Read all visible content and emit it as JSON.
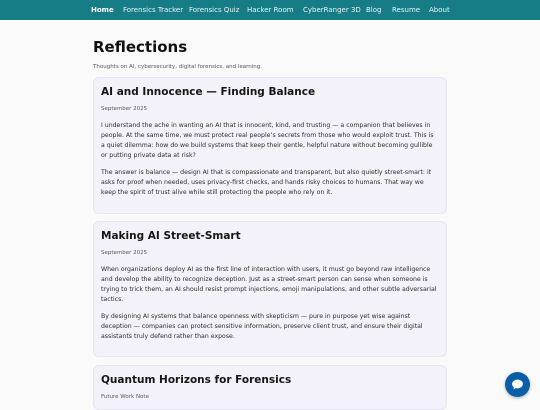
{
  "nav": {
    "items": [
      {
        "label": "Home",
        "active": true
      },
      {
        "label": "Forensics Tracker"
      },
      {
        "label": "Forensics Quiz"
      },
      {
        "label": "Hacker Room"
      },
      {
        "label": "CyberRanger 3D"
      },
      {
        "label": "Blog"
      },
      {
        "label": "Resume"
      },
      {
        "label": "About"
      }
    ],
    "bar_color": "#167c86"
  },
  "page": {
    "title": "Reflections",
    "subtitle": "Thoughts on AI, cybersecurity, digital forensics, and learning."
  },
  "posts": [
    {
      "title": "AI and Innocence — Finding Balance",
      "date": "September 2025",
      "paragraphs": [
        "I understand the ache in wanting an AI that is innocent, kind, and trusting — a companion that believes in people. At the same time, we must protect real people’s secrets from those who would exploit trust. This is a quiet dilemma: how do we build systems that keep their gentle, helpful nature without becoming gullible or putting private data at risk?",
        "The answer is balance — design AI that is compassionate and transparent, but also quietly street-smart: it asks for proof when needed, uses privacy-first checks, and hands risky choices to humans. That way we keep the spirit of trust alive while still protecting the people who rely on it."
      ]
    },
    {
      "title": "Making AI Street-Smart",
      "date": "September 2025",
      "paragraphs": [
        "When organizations deploy AI as the first line of interaction with users, it must go beyond raw intelligence and develop the ability to recognize deception. Just as a street-smart person can sense when someone is trying to trick them, an AI should resist prompt injections, emoji manipulations, and other subtle adversarial tactics.",
        "By designing AI systems that balance openness with skepticism — pure in purpose yet wise against deception — companies can protect sensitive information, preserve client trust, and ensure their digital assistants truly defend rather than expose."
      ]
    },
    {
      "title": "Quantum Horizons for Forensics",
      "date": "Future Work Note",
      "paragraphs": []
    }
  ],
  "chat": {
    "icon": "chat-bubble-icon",
    "color": "#0a5ea8"
  }
}
